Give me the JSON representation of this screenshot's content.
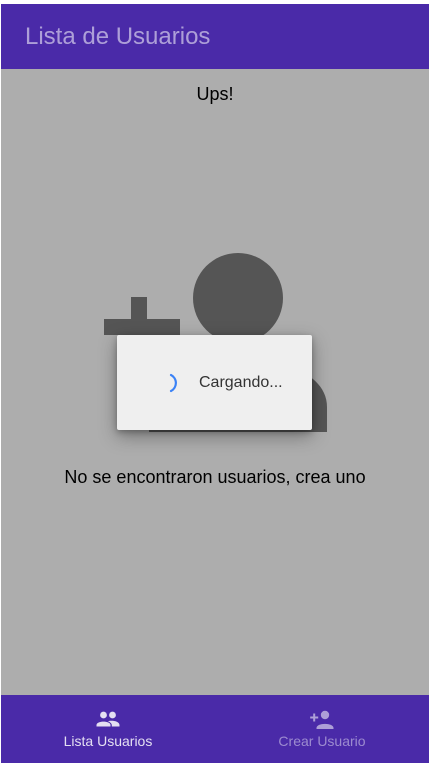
{
  "app_bar": {
    "title": "Lista de Usuarios"
  },
  "content": {
    "heading": "Ups!",
    "empty_icon": "add-user-icon",
    "empty_message": "No se encontraron usuarios, crea uno"
  },
  "dialog": {
    "spinner_icon": "spinner-icon",
    "loading_text": "Cargando..."
  },
  "bottom_nav": {
    "items": [
      {
        "label": "Lista Usuarios",
        "icon": "people-icon",
        "active": true
      },
      {
        "label": "Crear Usuario",
        "icon": "person-add-icon",
        "active": false
      }
    ]
  },
  "colors": {
    "primary": "#4a2aa8",
    "scrim": "#adadad",
    "dialog_bg": "#efefef",
    "spinner": "#3b82f6"
  }
}
